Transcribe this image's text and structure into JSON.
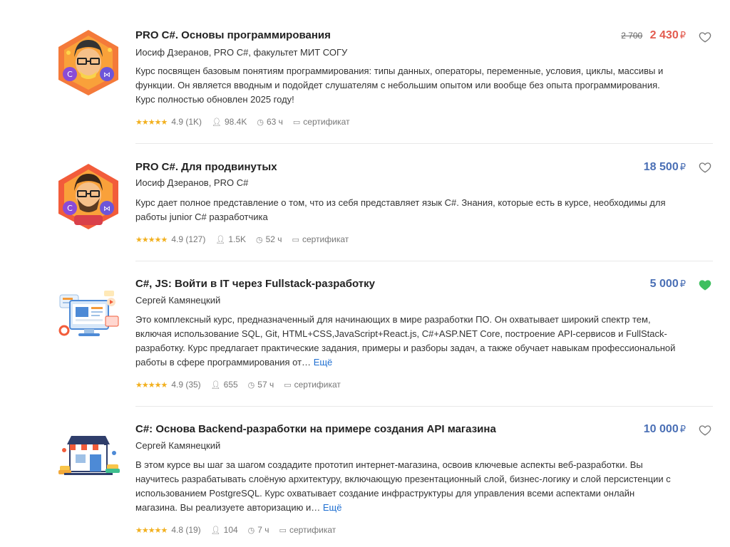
{
  "currency": "₽",
  "courses": [
    {
      "title": "PRO C#. Основы программирования",
      "author": "Иосиф Дзеранов, PRO C#, факультет МИТ СОГУ",
      "description": "Курс посвящен базовым понятиям программирования: типы данных, операторы, переменные, условия, циклы, массивы и функции. Он является вводным и подойдет слушателям с небольшим опытом или вообще без опыта программирования. Курс полностью обновлен 2025 году!",
      "more": "",
      "old_price": "2 700",
      "price": "2 430",
      "rating": "4.9 (1K)",
      "students": "98.4K",
      "hours": "63 ч",
      "certificate": "сертификат",
      "favorite": false,
      "thumb_icon": "developer-avatar-icon"
    },
    {
      "title": "PRO C#. Для продвинутых",
      "author": "Иосиф Дзеранов, PRO C#",
      "description": "Курс дает полное представление о том, что из себя представляет язык C#. Знания, которые есть в курсе, необходимы для работы junior C# разработчика",
      "more": "",
      "old_price": "",
      "price": "18 500",
      "rating": "4.9 (127)",
      "students": "1.5K",
      "hours": "52 ч",
      "certificate": "сертификат",
      "favorite": false,
      "thumb_icon": "bearded-developer-avatar-icon"
    },
    {
      "title": "C#, JS: Войти в IT через Fullstack-разработку",
      "author": "Сергей Камянецкий",
      "description": "Это комплексный курс, предназначенный для начинающих в мире разработки ПО. Он охватывает широкий спектр тем, включая использование SQL, Git, HTML+CSS,JavaScript+React.js, C#+ASP.NET Core, построение API-сервисов и FullStack-разработку. Курс предлагает практические задания, примеры и разборы задач, а также обучает навыкам профессиональной работы в сфере программирования от…",
      "more": "Ещё",
      "old_price": "",
      "price": "5 000",
      "rating": "4.9 (35)",
      "students": "655",
      "hours": "57 ч",
      "certificate": "сертификат",
      "favorite": true,
      "thumb_icon": "web-dashboard-icon"
    },
    {
      "title": "C#: Основа Backend-разработки на примере создания API магазина",
      "author": "Сергей Камянецкий",
      "description": "В этом курсе вы шаг за шагом создадите прототип интернет-магазина, освоив ключевые аспекты веб-разработки. Вы научитесь разрабатывать слоёную архитектуру, включающую презентационный слой, бизнес-логику и слой персистенции с использованием PostgreSQL. Курс охватывает создание инфраструктуры для управления всеми аспектами онлайн магазина. Вы реализуете авторизацию и…",
      "more": "Ещё",
      "old_price": "",
      "price": "10 000",
      "rating": "4.8 (19)",
      "students": "104",
      "hours": "7 ч",
      "certificate": "сертификат",
      "favorite": false,
      "thumb_icon": "online-store-icon"
    }
  ],
  "colors": {
    "price": "#4a6fb5",
    "sale_price": "#e35b4f",
    "favorite_active": "#3fbf5f",
    "stars": "#f2b01e",
    "link": "#1f6fd1"
  }
}
